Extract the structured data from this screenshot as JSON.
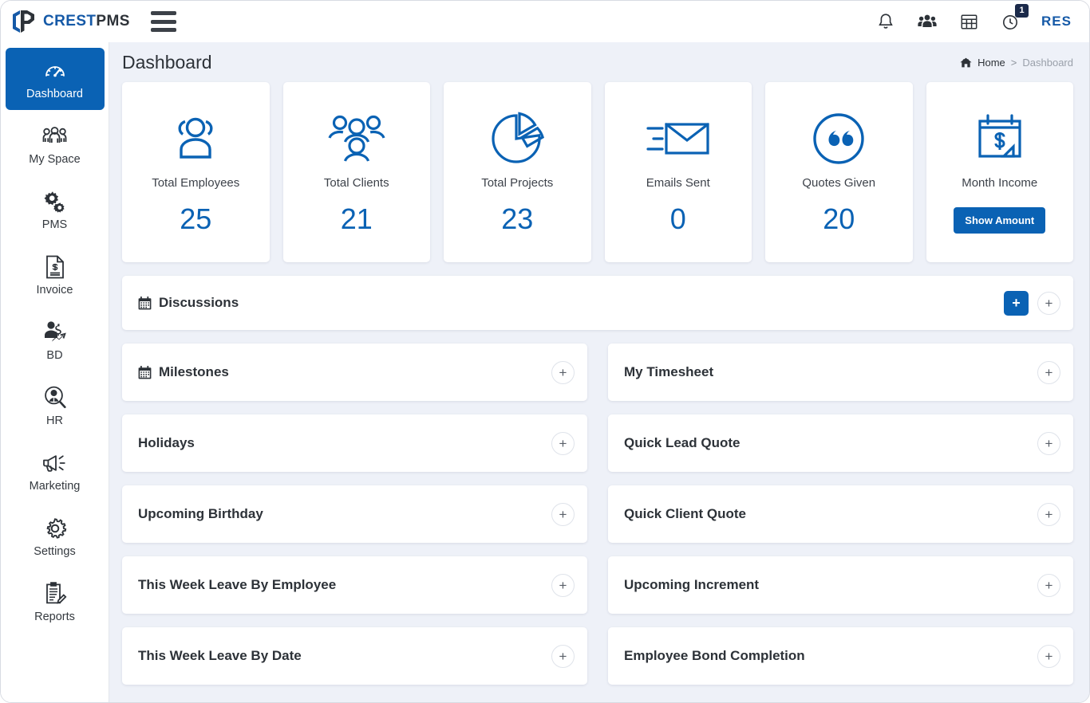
{
  "brand": {
    "crest": "CREST",
    "pms": "PMS"
  },
  "topbar": {
    "menu_icon": "hamburger-icon",
    "icons": [
      {
        "name": "notifications-icon",
        "label": "bell"
      },
      {
        "name": "team-icon",
        "label": "users"
      },
      {
        "name": "grid-icon",
        "label": "table"
      },
      {
        "name": "timer-icon",
        "label": "clock",
        "badge": "1"
      }
    ],
    "user_initials": "RES"
  },
  "sidebar": {
    "items": [
      {
        "label": "Dashboard",
        "icon": "speedometer-icon",
        "active": true
      },
      {
        "label": "My Space",
        "icon": "people-group-icon",
        "active": false
      },
      {
        "label": "PMS",
        "icon": "gears-icon",
        "active": false
      },
      {
        "label": "Invoice",
        "icon": "invoice-document-icon",
        "active": false
      },
      {
        "label": "BD",
        "icon": "business-development-icon",
        "active": false
      },
      {
        "label": "HR",
        "icon": "employee-search-icon",
        "active": false
      },
      {
        "label": "Marketing",
        "icon": "megaphone-icon",
        "active": false
      },
      {
        "label": "Settings",
        "icon": "gear-icon",
        "active": false
      },
      {
        "label": "Reports",
        "icon": "clipboard-edit-icon",
        "active": false
      }
    ]
  },
  "page": {
    "title": "Dashboard",
    "breadcrumb": {
      "home_icon": "home-icon",
      "home": "Home",
      "separator": ">",
      "current": "Dashboard"
    }
  },
  "stats": [
    {
      "label": "Total Employees",
      "value": "25",
      "icon": "employees-icon"
    },
    {
      "label": "Total Clients",
      "value": "21",
      "icon": "clients-icon"
    },
    {
      "label": "Total Projects",
      "value": "23",
      "icon": "pie-chart-icon"
    },
    {
      "label": "Emails Sent",
      "value": "0",
      "icon": "email-send-icon"
    },
    {
      "label": "Quotes Given",
      "value": "20",
      "icon": "quote-icon"
    },
    {
      "label": "Month Income",
      "value": "",
      "icon": "calendar-dollar-icon",
      "button": "Show Amount"
    }
  ],
  "discussions": {
    "title": "Discussions",
    "icon": "calendar-icon",
    "add_button": "+",
    "expand_button": "+"
  },
  "panels_left": [
    {
      "title": "Milestones",
      "icon": "calendar-icon",
      "button": "+"
    },
    {
      "title": "Holidays",
      "icon": "",
      "button": "+"
    },
    {
      "title": "Upcoming Birthday",
      "icon": "",
      "button": "+"
    },
    {
      "title": "This Week Leave By Employee",
      "icon": "",
      "button": "+"
    },
    {
      "title": "This Week Leave By Date",
      "icon": "",
      "button": "+"
    }
  ],
  "panels_right": [
    {
      "title": "My Timesheet",
      "icon": "",
      "button": "+"
    },
    {
      "title": "Quick Lead Quote",
      "icon": "",
      "button": "+"
    },
    {
      "title": "Quick Client Quote",
      "icon": "",
      "button": "+"
    },
    {
      "title": "Upcoming Increment",
      "icon": "",
      "button": "+"
    },
    {
      "title": "Employee Bond Completion",
      "icon": "",
      "button": "+"
    }
  ],
  "colors": {
    "accent_blue": "#0a62b4",
    "brand_blue": "#1559a7",
    "page_background": "#eef1f8",
    "card_background": "#ffffff",
    "text_dark": "#2d3238",
    "badge_navy": "#1b2a4a"
  }
}
